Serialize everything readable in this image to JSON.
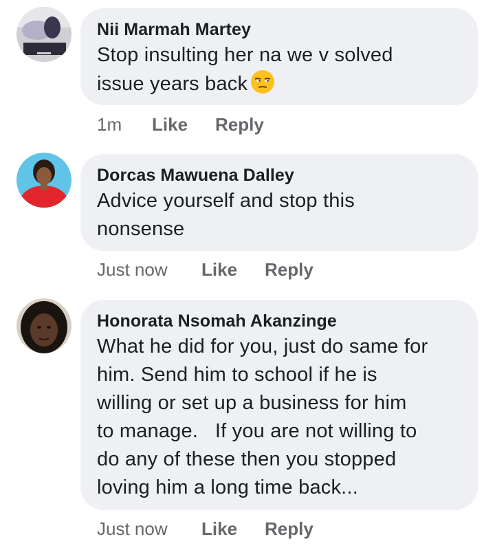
{
  "comments": [
    {
      "author": "Nii Marmah Martey",
      "text_line1": "Stop insulting her na we v solved",
      "text_line2": "issue years back",
      "emoji": "unamused-face-emoji",
      "time": "1m",
      "like_label": "Like",
      "reply_label": "Reply"
    },
    {
      "author": "Dorcas Mawuena Dalley",
      "text": "Advice yourself and stop this\nnonsense",
      "time": "Just now",
      "like_label": "Like",
      "reply_label": "Reply"
    },
    {
      "author": "Honorata Nsomah Akanzinge",
      "text": "What he did for you, just do same for\nhim. Send him to school if he is\nwilling or set up a business for him\nto manage.   If you are not willing to\ndo any of these then you stopped\nloving him a long time back...",
      "time": "Just now",
      "like_label": "Like",
      "reply_label": "Reply"
    }
  ],
  "colors": {
    "bubble": "#eef0f3",
    "text": "#1c1e21",
    "secondary": "#65676b"
  }
}
